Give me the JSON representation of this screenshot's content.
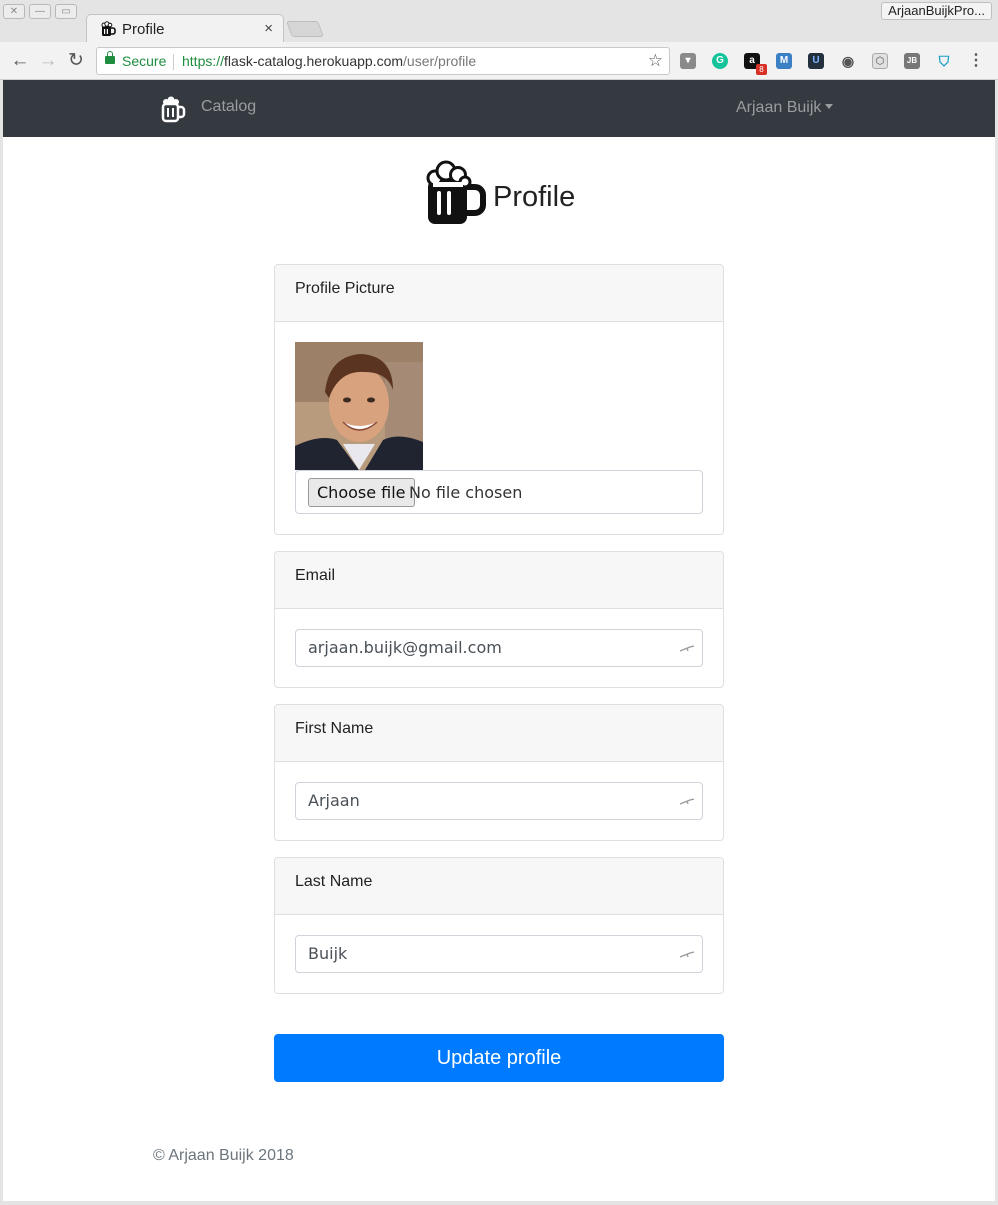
{
  "browser": {
    "tab_title": "Profile",
    "tab_close": "×",
    "profile_name": "ArjaanBuijkPro...",
    "secure_label": "Secure",
    "url_scheme": "https://",
    "url_host": "flask-catalog.herokuapp.com",
    "url_path": "/user/profile",
    "extension_badge": "8",
    "extensions": [
      "pocket-icon",
      "grammarly-icon",
      "amazon-icon",
      "m-icon",
      "u-icon",
      "eye-icon",
      "cube-icon",
      "jb-icon",
      "shield-icon",
      "menu-icon"
    ]
  },
  "navbar": {
    "brand_label": "Catalog",
    "user_label": "Arjaan Buijk"
  },
  "page": {
    "title": "Profile"
  },
  "form": {
    "picture_header": "Profile Picture",
    "choose_file_label": "Choose file",
    "no_file_label": "No file chosen",
    "email_header": "Email",
    "email_value": "arjaan.buijk@gmail.com",
    "first_name_header": "First Name",
    "first_name_value": "Arjaan",
    "last_name_header": "Last Name",
    "last_name_value": "Buijk",
    "submit_label": "Update profile"
  },
  "footer": {
    "text": "© Arjaan Buijk 2018"
  },
  "colors": {
    "navbar": "#343a40",
    "primary": "#007bff",
    "secure_green": "#1e8e3e"
  }
}
